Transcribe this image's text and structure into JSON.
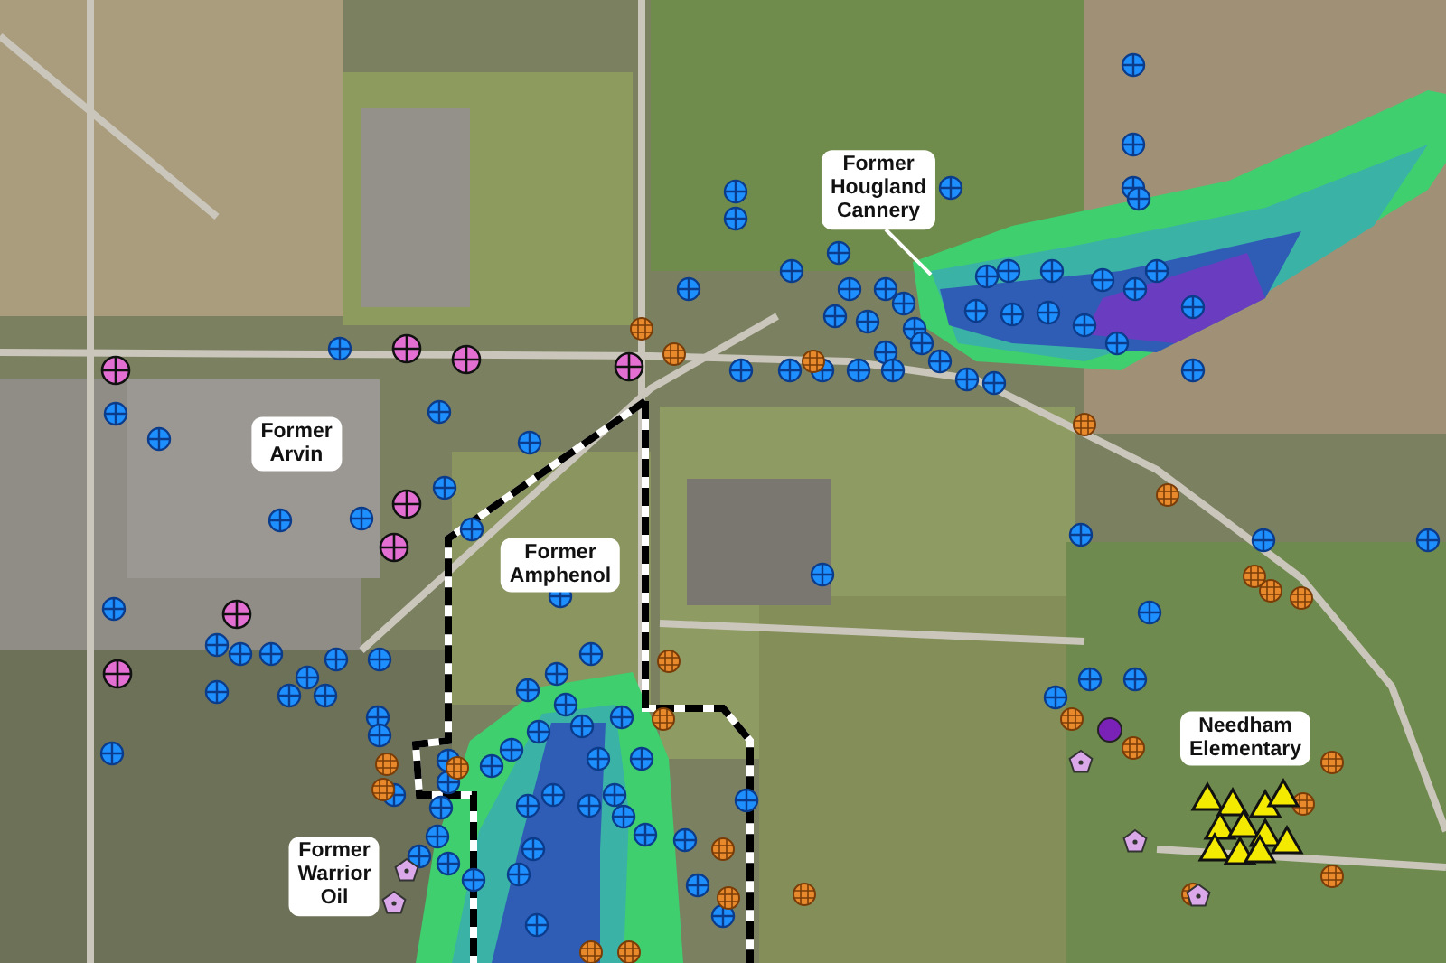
{
  "map": {
    "site_labels": [
      {
        "lines": [
          "Former",
          "Hougland",
          "Cannery"
        ]
      },
      {
        "lines": [
          "Former",
          "Arvin"
        ]
      },
      {
        "lines": [
          "Former",
          "Amphenol"
        ]
      },
      {
        "lines": [
          "Former",
          "Warrior",
          "Oil"
        ]
      },
      {
        "lines": [
          "Needham",
          "Elementary"
        ]
      }
    ]
  }
}
